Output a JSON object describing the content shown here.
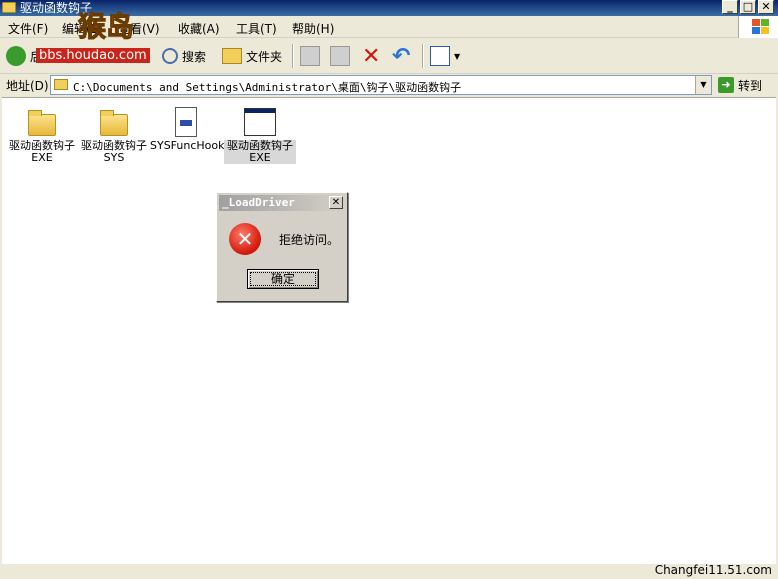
{
  "window": {
    "title": "驱动函数钩子",
    "buttons": {
      "minimize": "_",
      "maximize": "□",
      "close": "✕"
    }
  },
  "menu": [
    {
      "label": "文件(F)"
    },
    {
      "label": "编辑(E)"
    },
    {
      "label": "查看(V)"
    },
    {
      "label": "收藏(A)"
    },
    {
      "label": "工具(T)"
    },
    {
      "label": "帮助(H)"
    }
  ],
  "toolbar": {
    "back_label": "后退",
    "search_label": "搜索",
    "folders_label": "文件夹"
  },
  "watermark": {
    "site": "bbs.houdao.com",
    "name": "猴岛"
  },
  "address": {
    "label": "地址(D)",
    "value": "C:\\Documents and Settings\\Administrator\\桌面\\钩子\\驱动函数钩子",
    "go_label": "转到"
  },
  "files": [
    {
      "name": "驱动函数钩子EXE",
      "type": "folder-icon"
    },
    {
      "name": "驱动函数钩子SYS",
      "type": "folder-icon"
    },
    {
      "name": "SYSFuncHook",
      "type": "dll-icon"
    },
    {
      "name": "驱动函数钩子EXE",
      "type": "exe-icon"
    }
  ],
  "dialog": {
    "title": "_LoadDriver",
    "message": "拒绝访问。",
    "ok_label": "确定"
  },
  "credit": "Changfei11.51.com",
  "colors": {
    "titlebar": "#0a246a",
    "error_red": "#d0170a",
    "folder_yellow": "#f2cf5b"
  }
}
